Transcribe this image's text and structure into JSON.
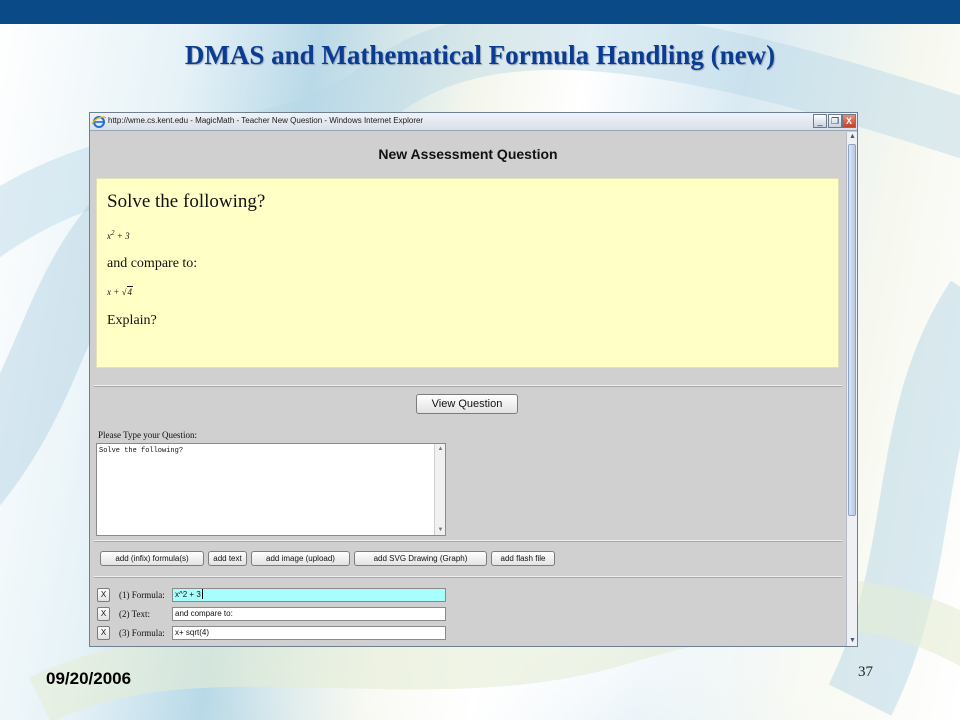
{
  "slide": {
    "title": "DMAS and Mathematical Formula Handling (new)",
    "date": "09/20/2006",
    "page_number": "37"
  },
  "browser": {
    "window_title": "http://wme.cs.kent.edu - MagicMath - Teacher New Question - Windows Internet Explorer",
    "minimize_label": "_",
    "restore_label": "❐",
    "close_label": "X"
  },
  "page": {
    "heading": "New Assessment Question",
    "preview": {
      "line1": "Solve the following?",
      "formula1_base": "x",
      "formula1_exp": "2",
      "formula1_rest": " + 3",
      "line2": "and compare to:",
      "formula2_prefix": "x + ",
      "formula2_radicand": "4",
      "line3": "Explain?"
    },
    "view_question_label": "View Question",
    "question_label": "Please Type your Question:",
    "question_value": "Solve the following?",
    "toolbar": {
      "add_formula": "add (infix) formula(s)",
      "add_text": "add text",
      "add_image": "add image (upload)",
      "add_svg": "add SVG Drawing (Graph)",
      "add_flash": "add flash file"
    },
    "rows": [
      {
        "remove": "X",
        "label": "(1) Formula:",
        "value": "x^2 + 3"
      },
      {
        "remove": "X",
        "label": "(2) Text:",
        "value": "and compare to:"
      },
      {
        "remove": "X",
        "label": "(3) Formula:",
        "value": "x+ sqrt(4)"
      }
    ]
  },
  "colors": {
    "topbar": "#0a4a86",
    "title": "#0b3c93",
    "preview_bg": "#ffffc6",
    "active_input": "#a8fdfd"
  }
}
